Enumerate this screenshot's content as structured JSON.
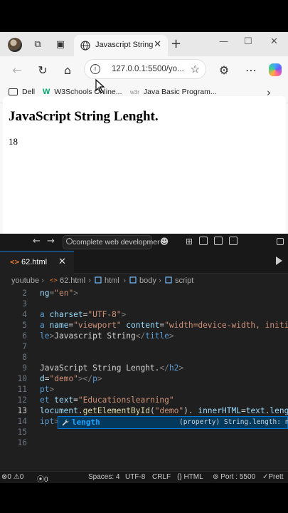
{
  "browser": {
    "tab_title": "Javascript String",
    "url": "127.0.0.1:5500/yo...",
    "bookmarks": [
      "Dell",
      "W3Schools Online...",
      "Java Basic Program..."
    ],
    "page": {
      "heading": "JavaScript String Lenght.",
      "demo_value": "18"
    }
  },
  "vscode": {
    "search_text": "complete web developmer",
    "tab_name": "62.html",
    "breadcrumb": [
      "youtube",
      "62.html",
      "html",
      "body",
      "script"
    ],
    "line_numbers": [
      "2",
      "3",
      "4",
      "5",
      "6",
      "7",
      "8",
      "9",
      "10",
      "11",
      "12",
      "13",
      "14",
      "15",
      "16"
    ],
    "suggestion": {
      "label": "length",
      "detail": "(property) String.length: numb"
    }
  },
  "status": {
    "errors": "0",
    "warnings": "0",
    "ports": "0",
    "spaces": "Spaces: 4",
    "encoding": "UTF-8",
    "eol": "CRLF",
    "language": "HTML",
    "port": "Port : 5500",
    "prettier": "Prett"
  },
  "colors": {
    "accent": "#0078d4",
    "editor_bg": "#1f1f1f",
    "string": "#ce9178",
    "attribute": "#9cdcfe",
    "keyword": "#569cd6"
  }
}
